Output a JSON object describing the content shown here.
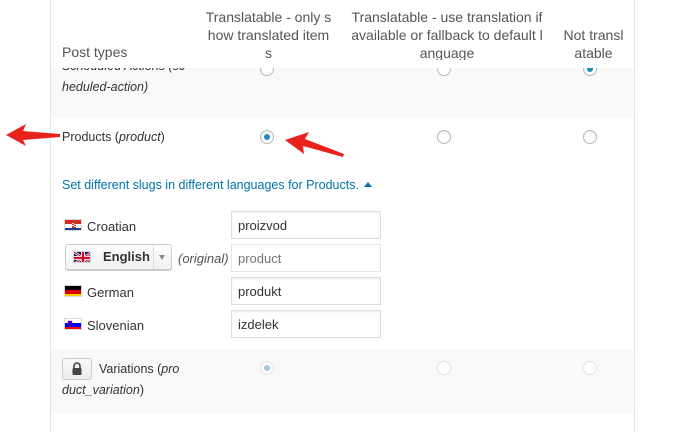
{
  "header": {
    "post_types": "Post types",
    "col1_line1": "Translatable - only s",
    "col1_line2": "how translated item",
    "col1_line3": "s",
    "col2_line1": "Translatable - use translation if",
    "col2_line2": "available or fallback to default l",
    "col2_line3": "anguage",
    "col3_line1": "Not transl",
    "col3_line2": "atable"
  },
  "rows": {
    "scheduled": {
      "line1": "Scheduled Actions (sc",
      "line2": "heduled-action)"
    },
    "products": {
      "label": "Products (",
      "slug": "product",
      "close": ")",
      "selected": "translatable-only"
    },
    "variations": {
      "label": "Variations (",
      "slug_line1": "pro",
      "slug_line2": "duct_variation",
      "close": ")"
    }
  },
  "slugs": {
    "toggle_link": "Set different slugs in different languages for Products.",
    "croatian": {
      "name": "Croatian",
      "value": "proizvod"
    },
    "english": {
      "name": "English",
      "original_label": "(original)",
      "placeholder": "product"
    },
    "german": {
      "name": "German",
      "value": "produkt"
    },
    "slovenian": {
      "name": "Slovenian",
      "value": "izdelek"
    }
  },
  "colors": {
    "accent": "#0073aa",
    "radio_checked": "#1e8cbe",
    "annotation_arrow": "#e8231c"
  },
  "icons": [
    "radio-icon",
    "caret-up-icon",
    "lock-icon",
    "flag-hr-icon",
    "flag-gb-icon",
    "flag-de-icon",
    "flag-si-icon",
    "red-arrow-icon"
  ]
}
